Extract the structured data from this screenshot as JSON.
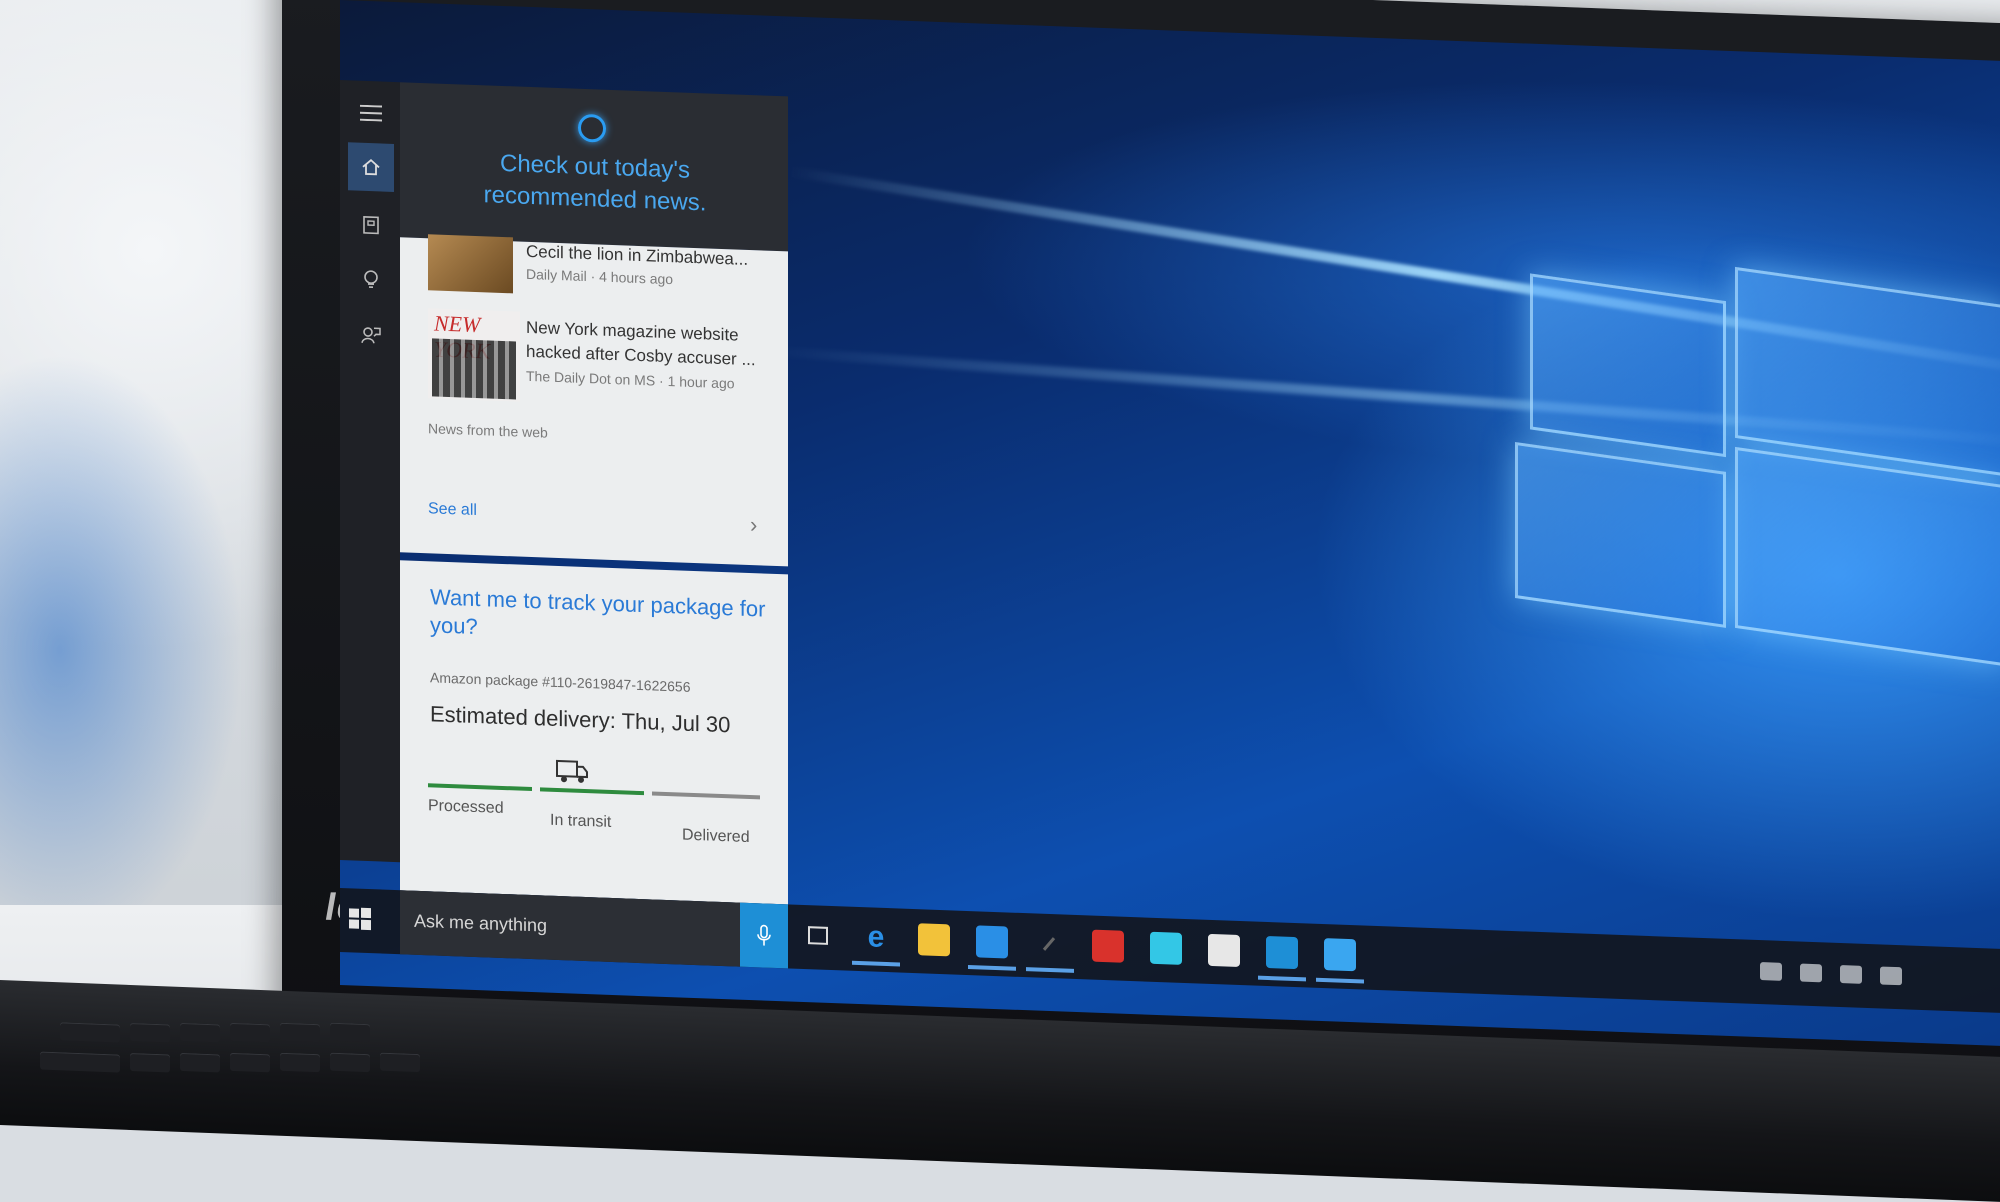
{
  "cortana": {
    "header_text": "Check out today's recommended news.",
    "news": [
      {
        "title": "Cecil the lion in Zimbabwea...",
        "meta": "Daily Mail · 4 hours ago"
      },
      {
        "title_line1": "New York magazine website",
        "title_line2": "hacked after Cosby accuser ...",
        "meta": "The Daily Dot on MS · 1 hour ago",
        "thumb_text": "NEW YORK"
      }
    ],
    "news_source": "News from the web",
    "see_all": "See all",
    "package": {
      "prompt": "Want me to track your package for you?",
      "id_text": "Amazon package #110-2619847-1622656",
      "eta": "Estimated delivery: Thu, Jul 30",
      "steps": [
        "Processed",
        "In transit",
        "Delivered"
      ],
      "current_step": "In transit",
      "colors": {
        "done": "#2e8b3e",
        "pending": "#8a8a8a"
      }
    }
  },
  "search": {
    "placeholder": "Ask me anything"
  },
  "taskbar": {
    "apps": [
      "task-view",
      "edge",
      "file-explorer",
      "store",
      "pen",
      "app-red",
      "app-cyan",
      "app-white",
      "settings",
      "app-blue"
    ],
    "accent": "#1e8fd6"
  },
  "brand": {
    "logo_text": "lenovo"
  },
  "icons": [
    "hamburger-icon",
    "home-icon",
    "notebook-icon",
    "lightbulb-icon",
    "feedback-icon",
    "windows-icon",
    "microphone-icon"
  ]
}
